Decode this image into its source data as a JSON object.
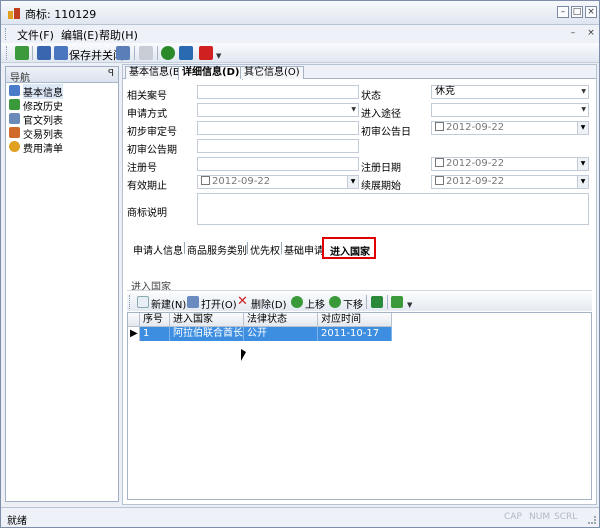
{
  "window": {
    "title": "商标: 110129"
  },
  "menu": [
    "文件(F)",
    "编辑(E)",
    "帮助(H)"
  ],
  "toolbar": {
    "save_close_label": "保存并关闭"
  },
  "nav": {
    "title": "导航",
    "pin": "ꟼ",
    "items": [
      {
        "label": "基本信息",
        "icon": "info-icon",
        "color": "#4a7bc8"
      },
      {
        "label": "修改历史",
        "icon": "history-icon",
        "color": "#3a9a3a"
      },
      {
        "label": "官文列表",
        "icon": "document-icon",
        "color": "#6a8ab8"
      },
      {
        "label": "交易列表",
        "icon": "list-icon",
        "color": "#d06a2a"
      },
      {
        "label": "费用清单",
        "icon": "coin-icon",
        "color": "#e0a020"
      }
    ]
  },
  "tabs": [
    "基本信息(B)",
    "详细信息(D)",
    "其它信息(O)"
  ],
  "form": {
    "related_case": "相关案号",
    "status_label": "状态",
    "status_value": "休克",
    "apply_method": "申请方式",
    "entry_route": "进入途径",
    "prelim_no": "初步审定号",
    "prelim_date": "初审公告日",
    "prelim_date_value": "2012-09-22",
    "prelim_period": "初审公告期",
    "reg_no": "注册号",
    "reg_date": "注册日期",
    "reg_date_value": "2012-09-22",
    "valid_until": "有效期止",
    "valid_until_value": "2012-09-22",
    "renewal_start": "续展期始",
    "renewal_start_value": "2012-09-22",
    "trademark_note": "商标说明"
  },
  "subtabs": [
    "申请人信息",
    "商品服务类别",
    "优先权",
    "基础申请",
    "进入国家"
  ],
  "group": {
    "title": "进入国家",
    "toolbar": [
      "新建(N)",
      "打开(O)",
      "删除(D)",
      "上移",
      "下移"
    ]
  },
  "grid": {
    "columns": [
      "序号",
      "进入国家",
      "法律状态",
      "对应时间"
    ],
    "rows": [
      [
        "1",
        "阿拉伯联合酋长国",
        "公开",
        "2011-10-17"
      ]
    ]
  },
  "status": {
    "text": "就绪",
    "indicators": [
      "CAP",
      "NUM",
      "SCRL"
    ]
  }
}
